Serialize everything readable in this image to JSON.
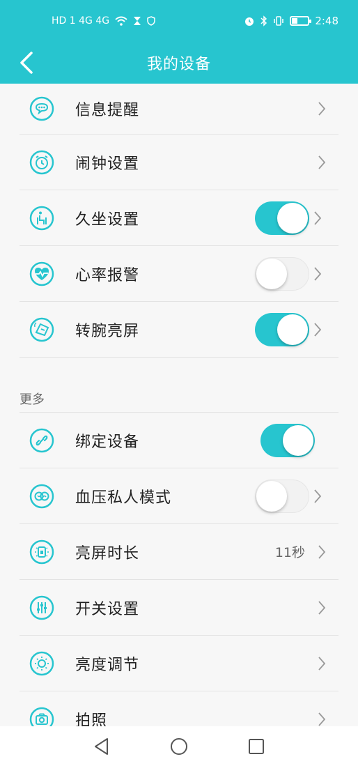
{
  "status_bar": {
    "left_text": "HD 1 4G 4G",
    "time": "2:48"
  },
  "header": {
    "title": "我的设备"
  },
  "main_items": [
    {
      "label": "信息提醒",
      "icon": "message-icon"
    },
    {
      "label": "闹钟设置",
      "icon": "alarm-icon"
    },
    {
      "label": "久坐设置",
      "icon": "sedentary-icon",
      "toggle": true
    },
    {
      "label": "心率报警",
      "icon": "heart-rate-icon",
      "toggle": false
    },
    {
      "label": "转腕亮屏",
      "icon": "wrist-icon",
      "toggle": true
    }
  ],
  "more_section": {
    "label": "更多",
    "items": [
      {
        "label": "绑定设备",
        "icon": "link-icon",
        "toggle": true
      },
      {
        "label": "血压私人模式",
        "icon": "blood-pressure-icon",
        "toggle": false
      },
      {
        "label": "亮屏时长",
        "icon": "screen-time-icon",
        "value": "11秒"
      },
      {
        "label": "开关设置",
        "icon": "sliders-icon"
      },
      {
        "label": "亮度调节",
        "icon": "brightness-icon"
      },
      {
        "label": "拍照",
        "icon": "camera-icon"
      }
    ]
  },
  "colors": {
    "accent": "#27c5cf",
    "background": "#f7f7f7",
    "text": "#222222"
  }
}
